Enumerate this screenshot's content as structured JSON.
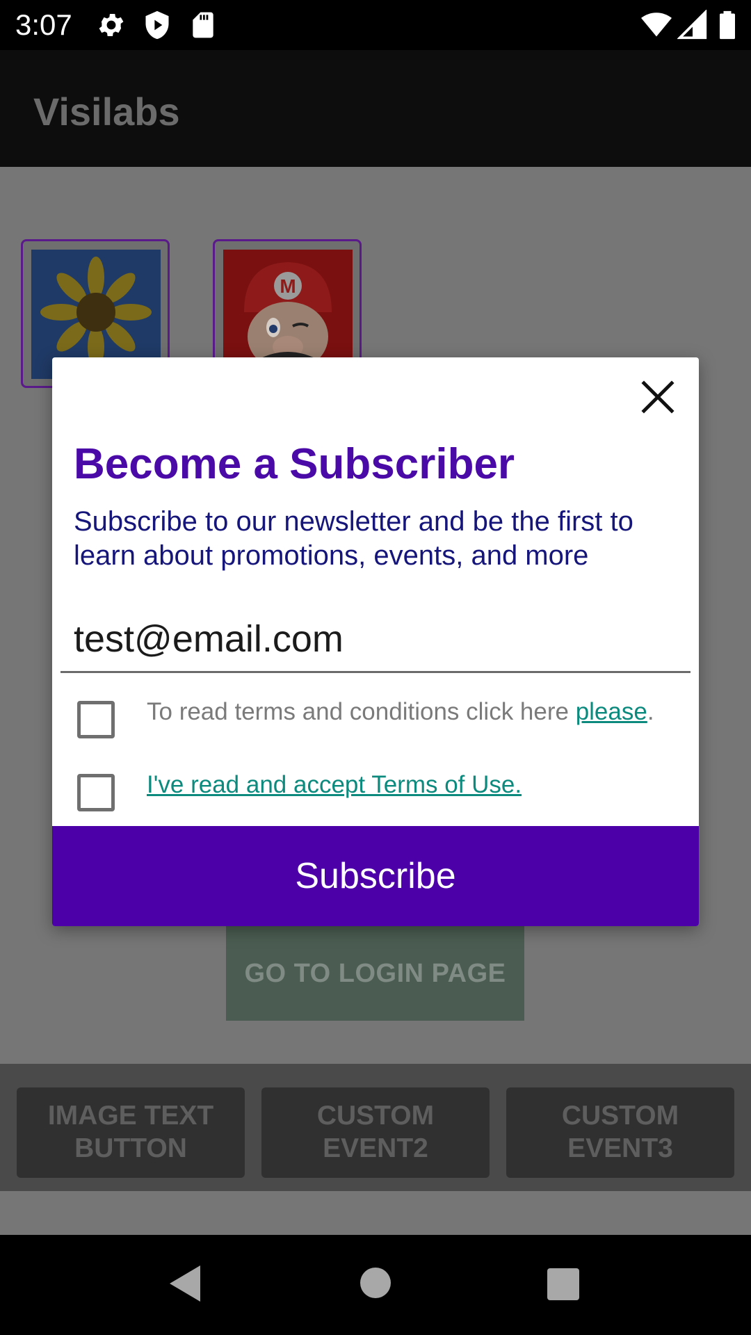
{
  "status_bar": {
    "time": "3:07",
    "icons": [
      "gear-icon",
      "play-protect-icon",
      "sd-card-icon",
      "wifi-icon",
      "signal-icon",
      "battery-icon"
    ]
  },
  "app_bar": {
    "title": "Visilabs"
  },
  "thumbnails": [
    {
      "name": "sunflower-image"
    },
    {
      "name": "mario-image"
    }
  ],
  "content": {
    "login_button": "GO TO LOGIN PAGE",
    "bottom_buttons": [
      {
        "label": "IMAGE TEXT\nBUTTON"
      },
      {
        "label": "CUSTOM\nEVENT2"
      },
      {
        "label": "CUSTOM\nEVENT3"
      }
    ]
  },
  "modal": {
    "title": "Become a Subscriber",
    "description": "Subscribe to our newsletter and be the first to learn about promotions, events, and more",
    "email_value": "test@email.com",
    "terms_prefix": "To read terms and conditions click here ",
    "terms_link": "please",
    "terms_suffix": ".",
    "accept_link": "I've read and accept Terms of Use.",
    "subscribe_label": "Subscribe"
  },
  "colors": {
    "title": "#4a0aa8",
    "description": "#15157a",
    "link": "#0d8a7e",
    "button": "#4b00a8"
  }
}
